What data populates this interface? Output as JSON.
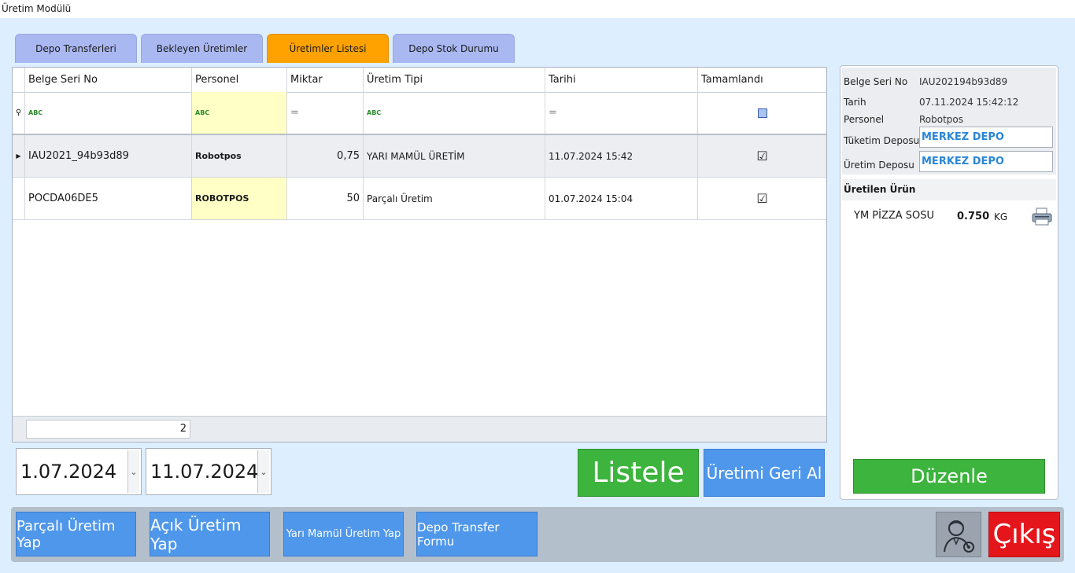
{
  "window": {
    "title": "Üretim Modülü"
  },
  "tabs": [
    {
      "label": "Depo Transferleri"
    },
    {
      "label": "Bekleyen Üretimler"
    },
    {
      "label": "Üretimler Listesi",
      "active": true
    },
    {
      "label": "Depo Stok Durumu"
    }
  ],
  "grid": {
    "columns": [
      "Belge Seri No",
      "Personel",
      "Miktar",
      "Üretim Tipi",
      "Tarihi",
      "Tamamlandı"
    ],
    "rows": [
      {
        "belge": "IAU2021_94b93d89",
        "personel": "Robotpos",
        "miktar": "0,75",
        "tip": "YARI MAMÜL ÜRETİM",
        "tarih": "11.07.2024 15:42",
        "tamam": "☑"
      },
      {
        "belge": "POCDA06DE5",
        "personel": "ROBOTPOS",
        "miktar": "50",
        "tip": "Parçalı Üretim",
        "tarih": "01.07.2024 15:04",
        "tamam": "☑"
      }
    ],
    "filter_abc": "ABC",
    "filter_eq": "=",
    "row_count": "2"
  },
  "dates": {
    "start": "1.07.2024",
    "end": "11.07.2024"
  },
  "buttons": {
    "listele": "Listele",
    "geri_al": "Üretimi Geri Al",
    "duzenle": "Düzenle",
    "parcali": "Parçalı Üretim Yap",
    "acik": "Açık Üretim Yap",
    "yari": "Yarı Mamül Üretim Yap",
    "transfer": "Depo Transfer Formu",
    "cikis": "Çıkış"
  },
  "detail": {
    "belge_label": "Belge Seri No",
    "belge_value": "IAU202194b93d89",
    "tarih_label": "Tarih",
    "tarih_value": "07.11.2024 15:42:12",
    "personel_label": "Personel",
    "personel_value": "Robotpos",
    "tuketim_label": "Tüketim Deposu",
    "tuketim_value": "MERKEZ DEPO",
    "uretim_label": "Üretim Deposu",
    "uretim_value": "MERKEZ DEPO",
    "urun_header": "Üretilen Ürün",
    "urun_name": "YM PİZZA SOSU",
    "urun_qty": "0.750",
    "urun_unit": "KG"
  },
  "colors": {
    "tab_active": "#ffa200",
    "tab": "#aab8f2",
    "green": "#3db43d",
    "blue": "#4f97ea",
    "red": "#e4161b"
  }
}
